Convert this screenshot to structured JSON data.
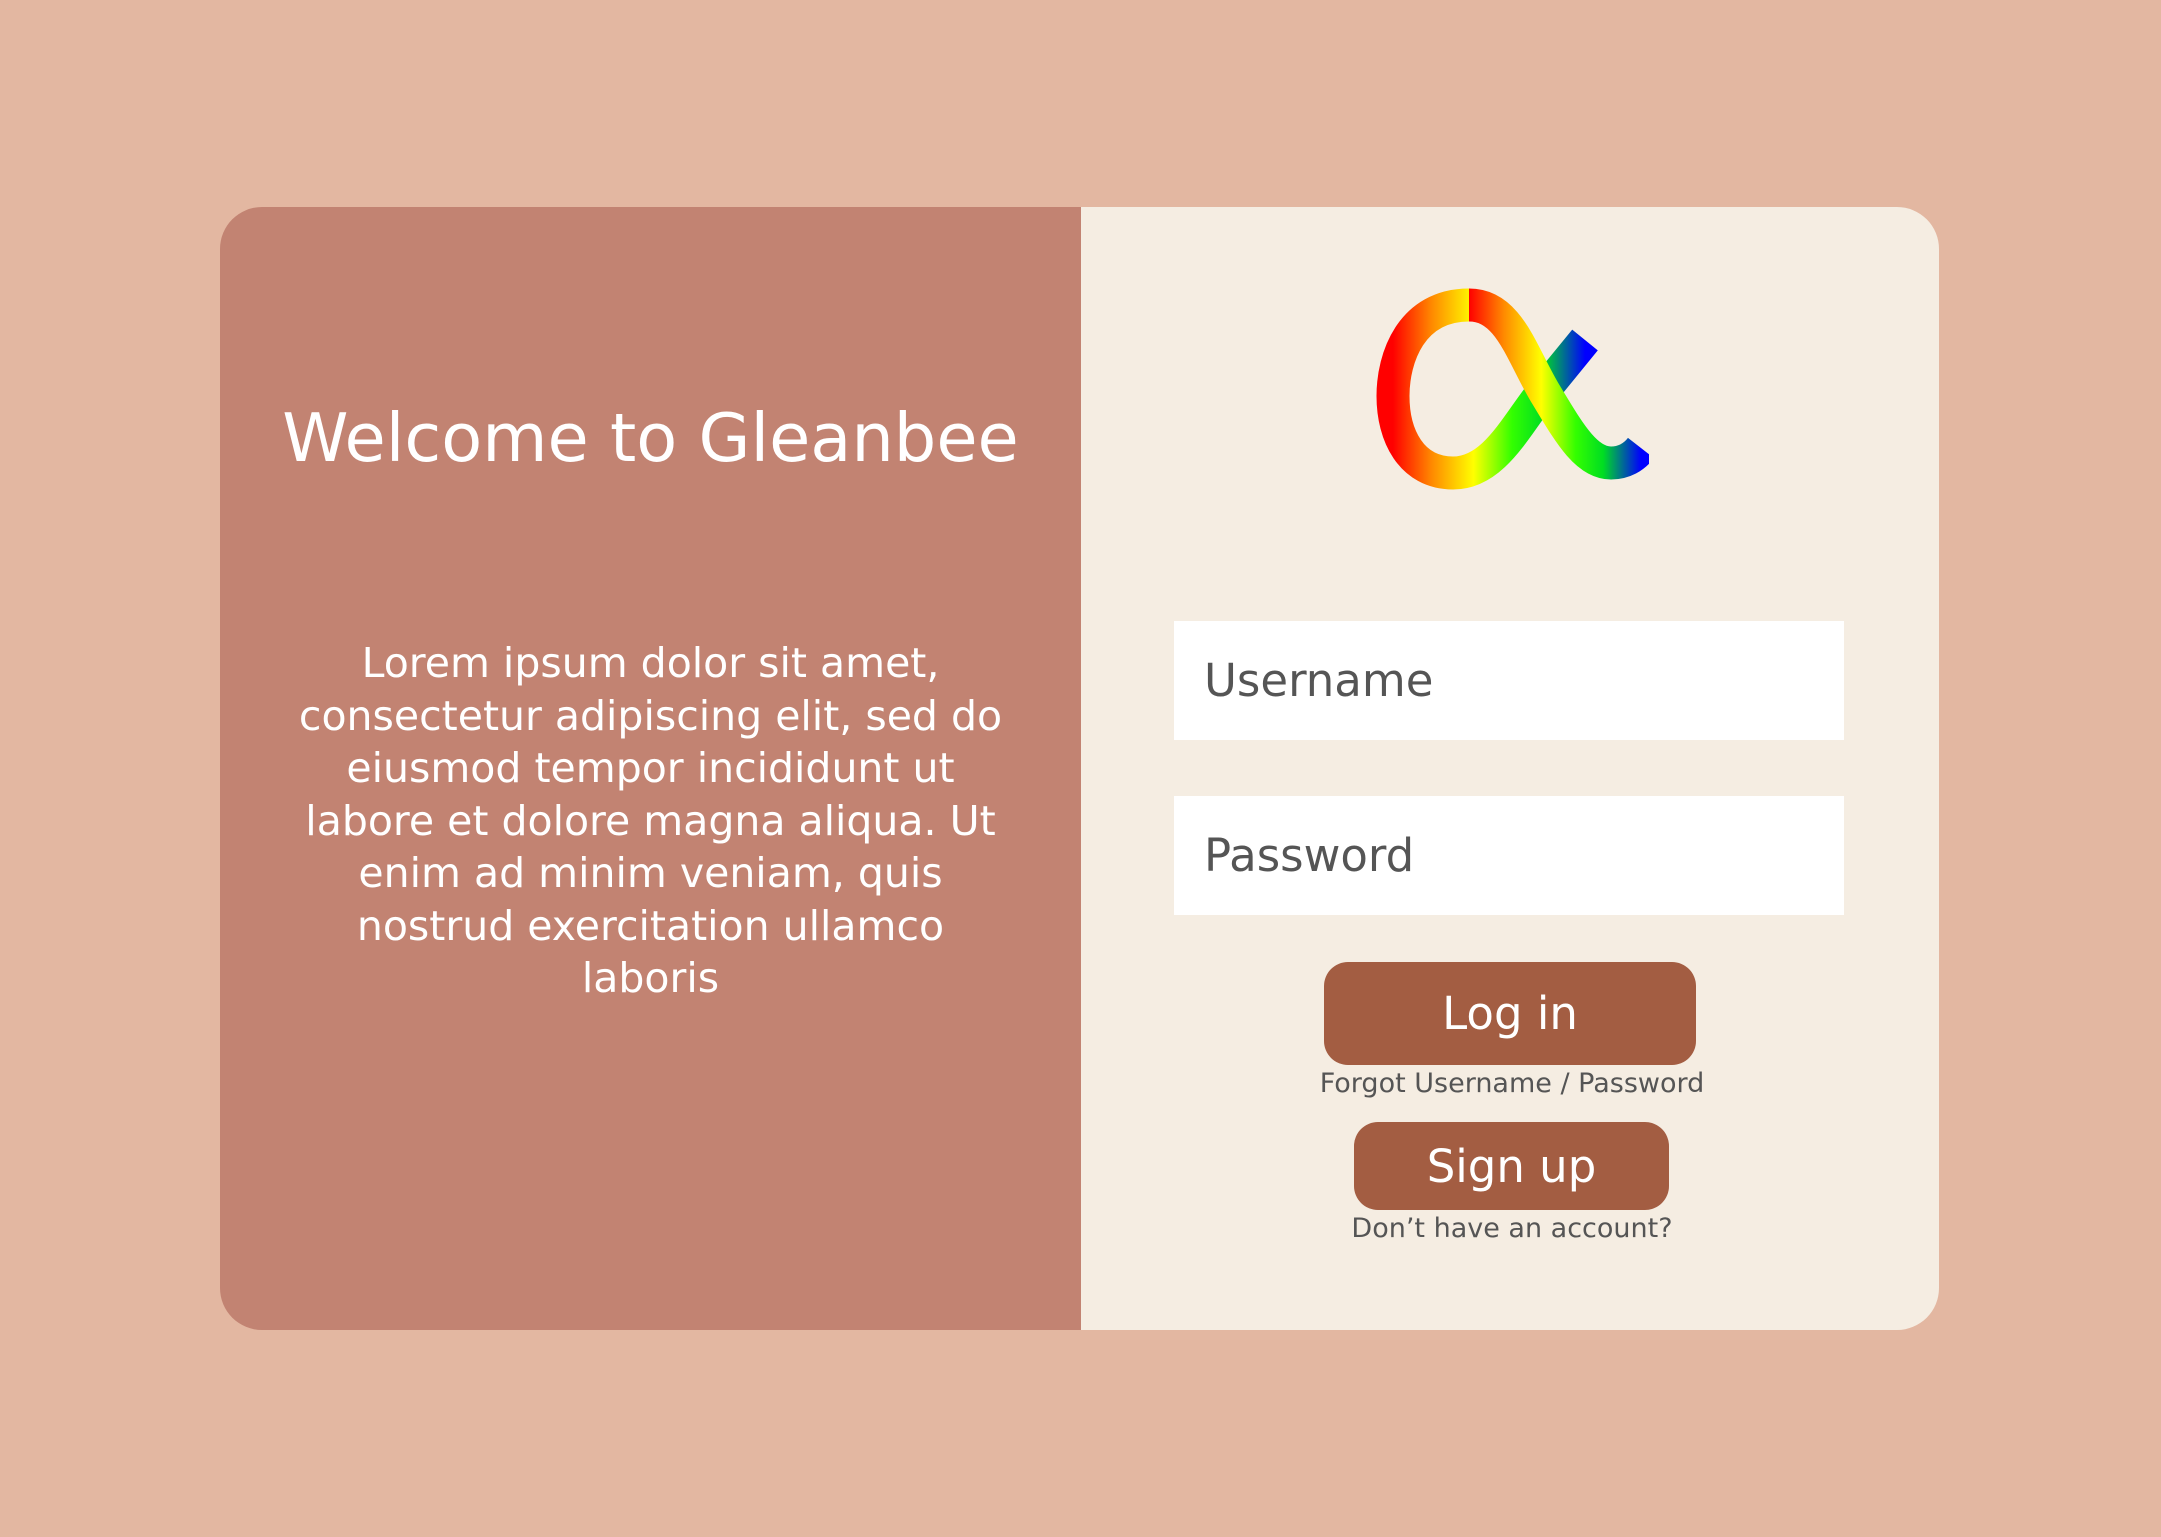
{
  "colors": {
    "page_background": "#e3b7a1",
    "left_panel": "#c28372",
    "right_panel": "#f5ede2",
    "button": "#a35d42",
    "input_background": "#ffffff"
  },
  "welcome_panel": {
    "title": "Welcome to Gleanbee",
    "description": "Lorem ipsum dolor sit amet, consectetur adipiscing elit, sed do eiusmod tempor incididunt ut labore et dolore magna aliqua. Ut enim ad minim veniam, quis nostrud exercitation ullamco laboris"
  },
  "login_form": {
    "logo_icon": "rainbow-alpha-logo",
    "username": {
      "placeholder": "Username",
      "value": ""
    },
    "password": {
      "placeholder": "Password",
      "value": ""
    },
    "login_label": "Log in",
    "forgot_label": "Forgot Username / Password",
    "signup_label": "Sign up",
    "no_account_label": "Don’t have an account?"
  }
}
